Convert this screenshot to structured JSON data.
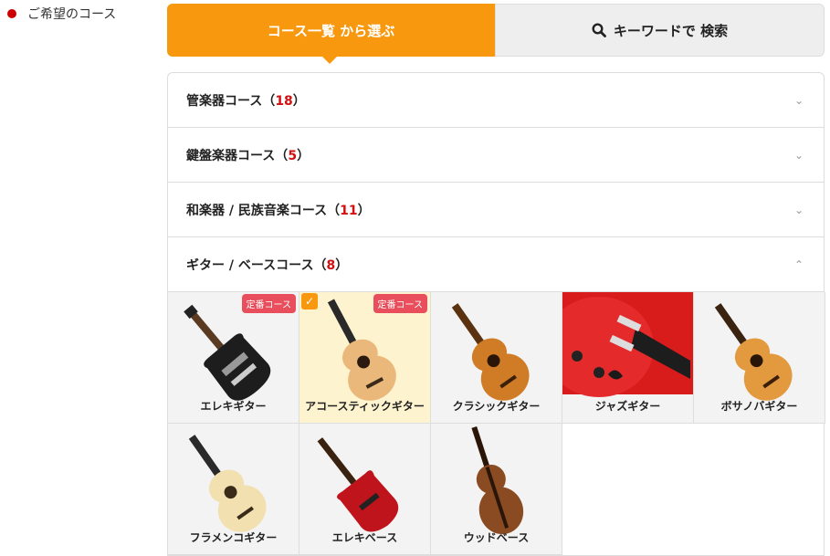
{
  "left_label": "ご希望のコース",
  "tabs": {
    "list_label": "コース一覧 から選ぶ",
    "keyword_label": "キーワードで 検索"
  },
  "categories": [
    {
      "name": "管楽器コース（",
      "count": "18",
      "close": "）",
      "expanded": false
    },
    {
      "name": "鍵盤楽器コース（",
      "count": "5",
      "close": "）",
      "expanded": false
    },
    {
      "name": "和楽器 / 民族音楽コース（",
      "count": "11",
      "close": "）",
      "expanded": false
    },
    {
      "name": "ギター / ベースコース（",
      "count": "8",
      "close": "）",
      "expanded": true
    }
  ],
  "courses": [
    {
      "label": "エレキギター",
      "badge": "定番コース",
      "selected": false
    },
    {
      "label": "アコースティックギター",
      "badge": "定番コース",
      "selected": true
    },
    {
      "label": "クラシックギター",
      "badge": "",
      "selected": false
    },
    {
      "label": "ジャズギター",
      "badge": "",
      "selected": false
    },
    {
      "label": "ボサノバギター",
      "badge": "",
      "selected": false
    },
    {
      "label": "フラメンコギター",
      "badge": "",
      "selected": false
    },
    {
      "label": "エレキベース",
      "badge": "",
      "selected": false
    },
    {
      "label": "ウッドベース",
      "badge": "",
      "selected": false
    }
  ],
  "colors": {
    "accent": "#f7980f",
    "count_red": "#d30f0f",
    "badge_pink": "#e84e5b",
    "bullet_red": "#cc0000"
  }
}
